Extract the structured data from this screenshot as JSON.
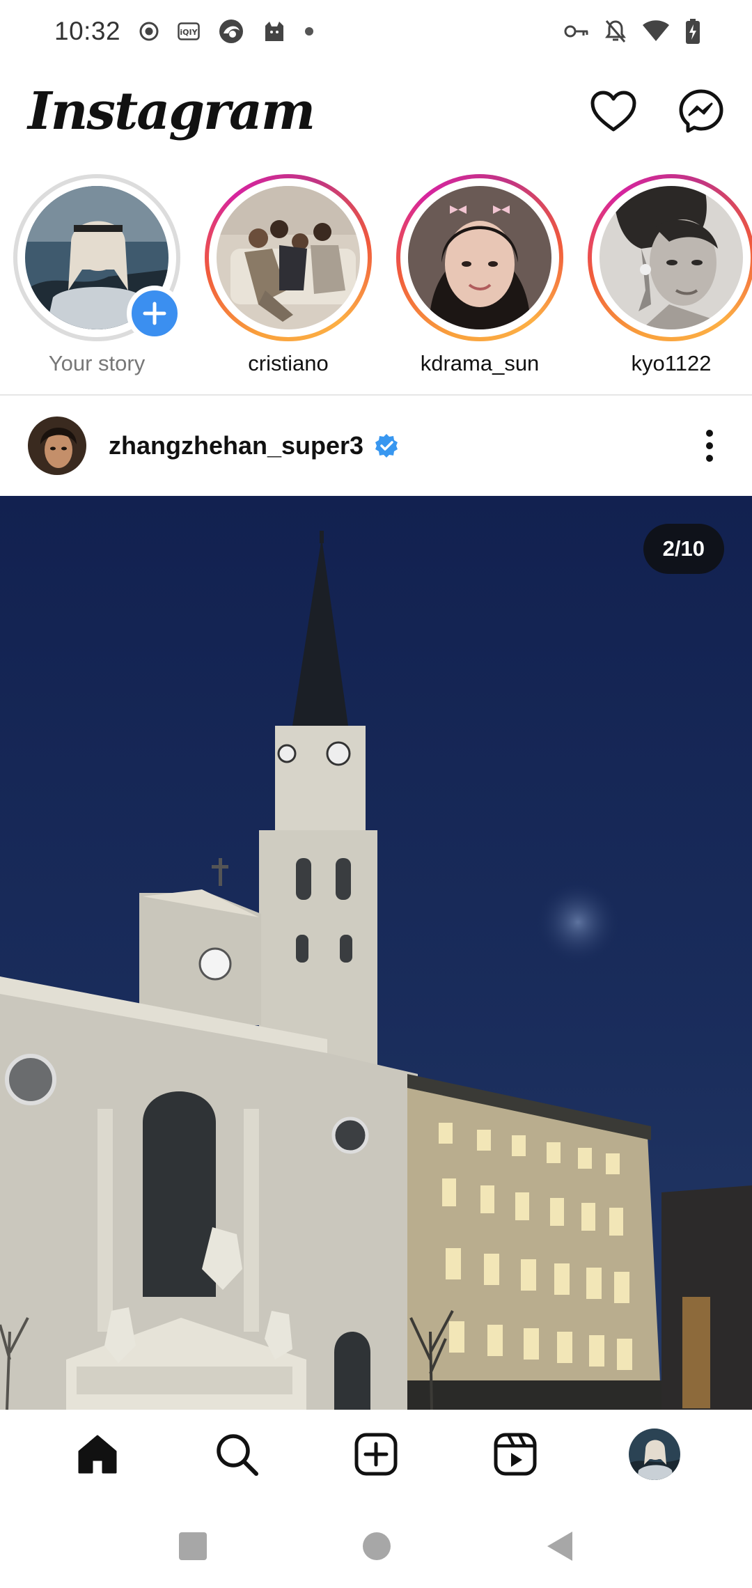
{
  "status_bar": {
    "time": "10:32",
    "left_icons": [
      "record-icon",
      "iqiyi-icon",
      "browser-icon",
      "cat-app-icon",
      "dot-icon"
    ],
    "right_icons": [
      "vpn-key-icon",
      "notifications-off-icon",
      "wifi-icon",
      "battery-charging-icon"
    ]
  },
  "header": {
    "logo": "Instagram",
    "actions": [
      "heart-icon",
      "messenger-icon"
    ]
  },
  "stories": [
    {
      "name": "Your story",
      "own": true
    },
    {
      "name": "cristiano",
      "own": false
    },
    {
      "name": "kdrama_sun",
      "own": false
    },
    {
      "name": "kyo1122",
      "own": false
    }
  ],
  "post": {
    "username": "zhangzhehan_super3",
    "verified": true,
    "counter": "2/10"
  },
  "bottom_nav": [
    "home-icon",
    "search-icon",
    "create-post-icon",
    "reels-icon",
    "profile-avatar"
  ],
  "system_nav": [
    "recents-icon",
    "home-circle-icon",
    "back-icon"
  ],
  "colors": {
    "accent_blue": "#3b8ff0",
    "verified_blue": "#3897f0",
    "story_ring_start": "#f9a13c",
    "story_ring_end": "#d6249f",
    "sky": "#14244e"
  }
}
